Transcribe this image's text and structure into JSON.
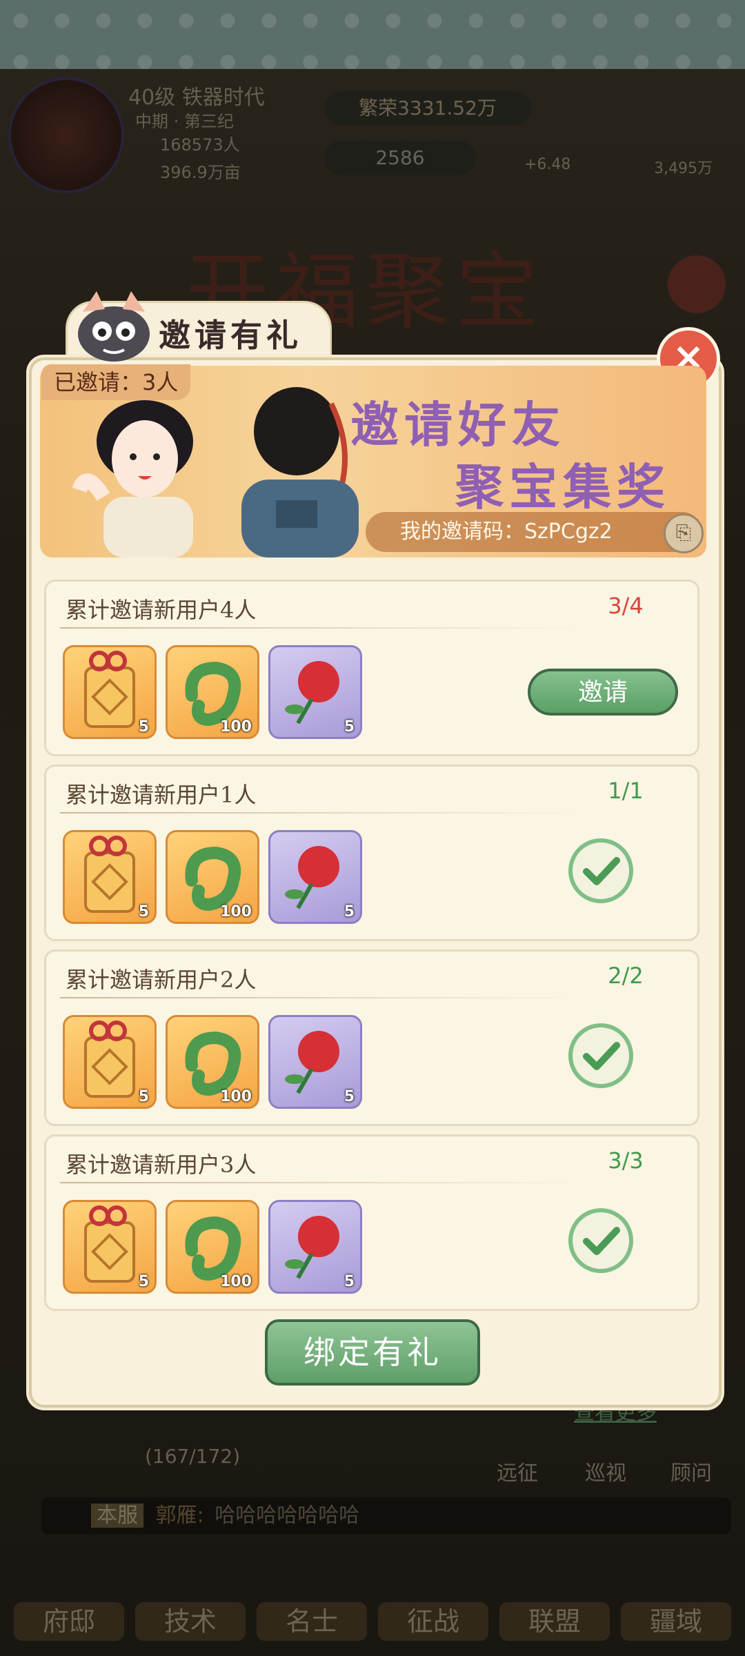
{
  "hud": {
    "level": "40级 铁器时代",
    "era": "中期 · 第三纪",
    "population": "168573人",
    "land": "396.9万亩",
    "prosperity": "繁荣3331.52万",
    "jade": "2586",
    "stat_mid": "+6.48",
    "stat_right": "3,495万"
  },
  "background": {
    "big_title": "开福聚宝",
    "progress": "(167/172)",
    "links": [
      "远征",
      "巡视",
      "顾问"
    ],
    "view_more": "查看更多"
  },
  "chat": {
    "channel": "本服",
    "user": "郭雁:",
    "message": "哈哈哈哈哈哈哈"
  },
  "nav": [
    "府邸",
    "技术",
    "名士",
    "征战",
    "联盟",
    "疆域"
  ],
  "modal": {
    "title": "邀请有礼",
    "close": "×",
    "invited": "已邀请：3人",
    "banner_line1": "邀请好友",
    "banner_line2": "聚宝集奖",
    "invite_code": "我的邀请码：SzPCgz2",
    "tasks": [
      {
        "title": "累计邀请新用户4人",
        "progress": "3/4",
        "done": false,
        "action": "邀请",
        "items": [
          "5",
          "100",
          "5"
        ]
      },
      {
        "title": "累计邀请新用户1人",
        "progress": "1/1",
        "done": true,
        "items": [
          "5",
          "100",
          "5"
        ]
      },
      {
        "title": "累计邀请新用户2人",
        "progress": "2/2",
        "done": true,
        "items": [
          "5",
          "100",
          "5"
        ]
      },
      {
        "title": "累计邀请新用户3人",
        "progress": "3/3",
        "done": true,
        "items": [
          "5",
          "100",
          "5"
        ]
      }
    ],
    "bind_button": "绑定有礼"
  },
  "colors": {
    "progress_incomplete": "#d9443a",
    "progress_complete": "#3f9a4a",
    "accent_green": "#5aa065",
    "banner_text": "#8f5fb3"
  }
}
